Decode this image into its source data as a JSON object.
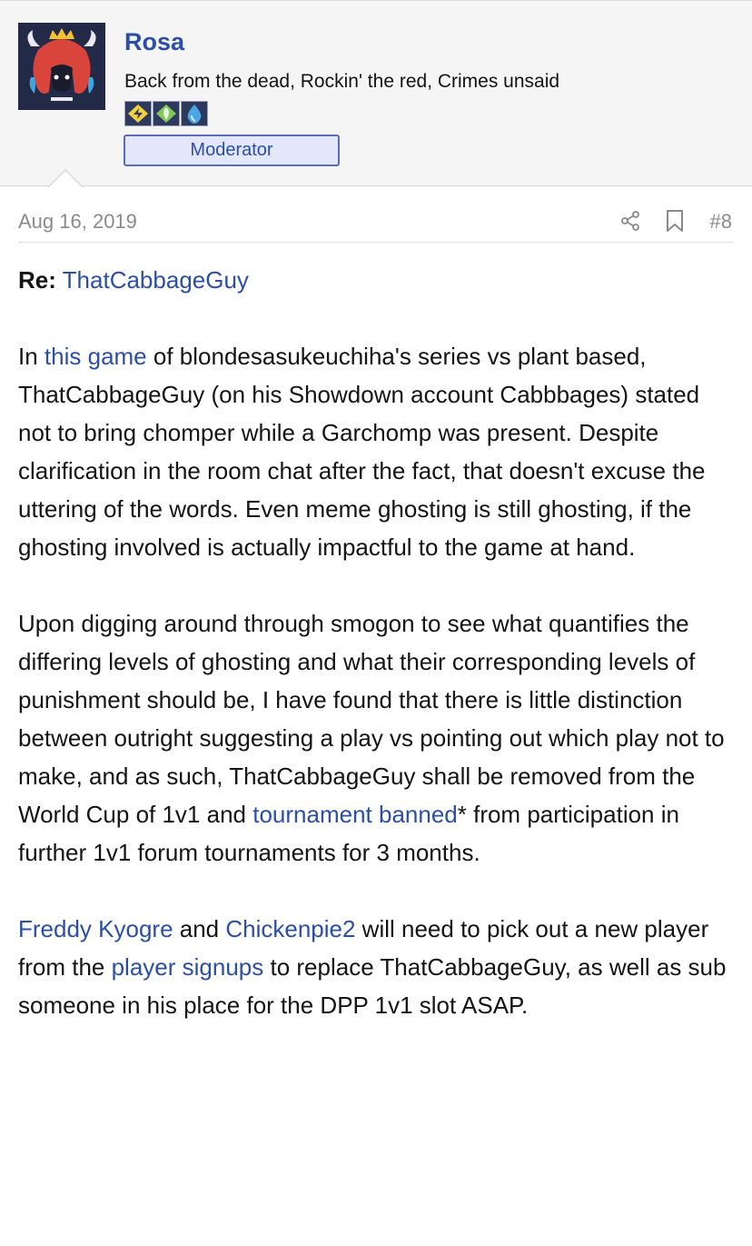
{
  "user": {
    "name": "Rosa",
    "title": "Back from the dead, Rockin' the red, Crimes unsaid",
    "banner": "Moderator",
    "badge_icons": [
      "electric-type-badge-icon",
      "grass-type-badge-icon",
      "water-type-badge-icon"
    ]
  },
  "post": {
    "date": "Aug 16, 2019",
    "number": "#8",
    "re_label": "Re:",
    "re_target": "ThatCabbageGuy",
    "p1": {
      "pre": "In ",
      "link": "this game",
      "rest": " of blondesasukeuchiha's series vs plant based, ThatCabbageGuy (on his Showdown account Cabbbages) stated not to bring chomper while a Garchomp was present. Despite clarification in the room chat after the fact, that doesn't excuse the uttering of the words. Even meme ghosting is still ghosting, if the ghosting involved is actually impactful to the game at hand."
    },
    "p2": {
      "pre": "Upon digging around through smogon to see what quantifies the differing levels of ghosting and what their corresponding levels of punishment should be, I have found that there is little distinction between outright suggesting a play vs pointing out which play not to make, and as such, ThatCabbageGuy shall be removed from the World Cup of 1v1 and ",
      "link": "tournament banned",
      "rest": "* from participation in further 1v1 forum tournaments for 3 months."
    },
    "p3": {
      "link1": "Freddy Kyogre",
      "mid1": " and ",
      "link2": "Chickenpie2",
      "mid2": " will need to pick out a new player from the ",
      "link3": "player signups",
      "rest": " to replace ThatCabbageGuy, as well as sub someone in his place for the DPP 1v1 slot ASAP."
    }
  },
  "colors": {
    "link": "#2b4fa8",
    "banner_bg": "#e4e6fb",
    "banner_border": "#5b6cbf",
    "muted": "#8a8a8a"
  }
}
